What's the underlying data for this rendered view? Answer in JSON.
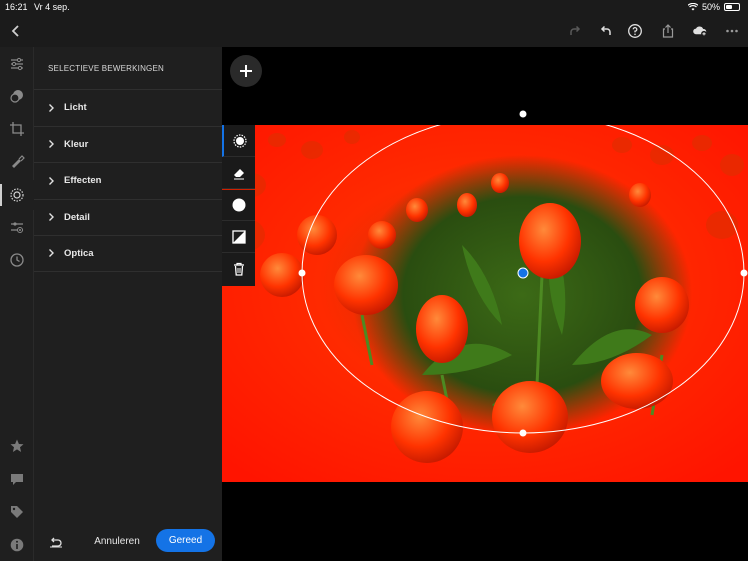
{
  "status_bar": {
    "time": "16:21",
    "date": "Vr 4 sep.",
    "battery": "50%",
    "battery_level": 0.5
  },
  "toolbar": {
    "back": "chevron-left-icon",
    "redo": "redo-icon",
    "undo": "undo-icon",
    "help": "help-icon",
    "share": "share-icon",
    "cloud": "cloud-add-icon",
    "more": "more-icon"
  },
  "rail": [
    "sliders-icon",
    "presets-icon",
    "crop-icon",
    "healing-icon",
    "selective-icon",
    "versions-icon",
    "history-icon",
    "star-icon",
    "comment-icon",
    "tag-icon",
    "info-icon"
  ],
  "panel": {
    "title": "SELECTIEVE BEWERKINGEN",
    "sections": [
      "Licht",
      "Kleur",
      "Effecten",
      "Detail",
      "Optica"
    ],
    "cancel_label": "Annuleren",
    "done_label": "Gereed"
  },
  "colors": {
    "accent": "#1473e6",
    "mask": "#ff1a00",
    "panel": "#1f1f1f"
  },
  "mask_tools": [
    "radial-gradient-icon",
    "eraser-icon",
    "brush-icon",
    "invert-mask-icon",
    "trash-icon"
  ]
}
